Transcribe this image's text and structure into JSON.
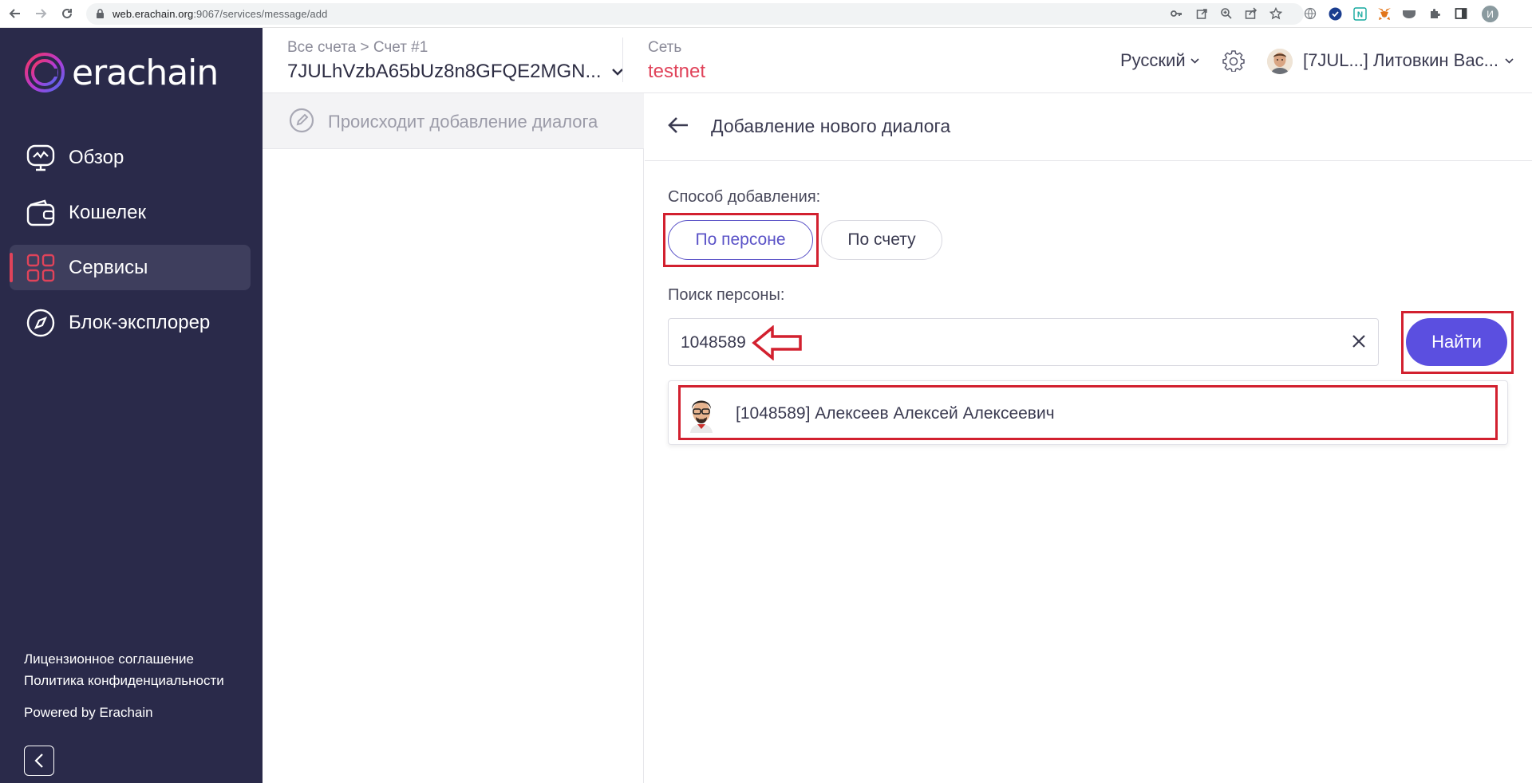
{
  "browser": {
    "url_host": "web.erachain.org",
    "url_path": ":9067/services/message/add",
    "profile_initial": "И"
  },
  "sidebar": {
    "logo_text": "erachain",
    "items": [
      {
        "label": "Обзор",
        "icon": "monitor-icon",
        "active": false
      },
      {
        "label": "Кошелек",
        "icon": "wallet-icon",
        "active": false
      },
      {
        "label": "Сервисы",
        "icon": "grid-icon",
        "active": true
      },
      {
        "label": "Блок-эксплорер",
        "icon": "compass-icon",
        "active": false
      }
    ],
    "footer": {
      "license": "Лицензионное соглашение",
      "privacy": "Политика конфиденциальности",
      "powered": "Powered by Erachain"
    }
  },
  "header": {
    "breadcrumb": "Все счета > Счет #1",
    "account_address": "7JULhVzbA65bUz8n8GFQE2MGN...",
    "network_label": "Сеть",
    "network_value": "testnet",
    "language": "Русский",
    "user_name": "[7JUL...] Литовкин Вас..."
  },
  "list": {
    "items": [
      {
        "label": "Происходит добавление диалога"
      }
    ]
  },
  "main": {
    "title": "Добавление нового диалога",
    "method_label": "Способ добавления:",
    "method_options": [
      {
        "label": "По персоне",
        "selected": true
      },
      {
        "label": "По счету",
        "selected": false
      }
    ],
    "search_label": "Поиск персоны:",
    "search_value": "1048589",
    "find_label": "Найти",
    "result_text": "[1048589] Алексеев Алексей Алексеевич"
  },
  "colors": {
    "sidebar_bg": "#2a2a4a",
    "accent": "#5b4fe0",
    "network": "#e0435a",
    "annotation": "#d2202f"
  }
}
